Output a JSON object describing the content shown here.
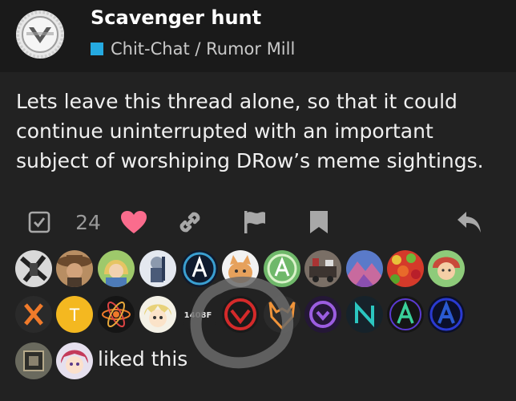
{
  "topic": {
    "title": "Scavenger hunt",
    "category": "Chit-Chat / Rumor Mill",
    "category_color": "#25aae1"
  },
  "post": {
    "body": "Lets leave this thread alone, so that it could continue uninterrupted with an important subject of worshiping DRow’s meme sightings."
  },
  "actions": {
    "like_count": "24",
    "like_color": "#fa6c8d",
    "icons": [
      "checkbox-icon",
      "heart-icon",
      "link-icon",
      "flag-icon",
      "bookmark-icon",
      "reply-icon"
    ]
  },
  "likers": {
    "text": "liked this",
    "avatar_badge": "1408F",
    "avatar_letter_t": "T"
  },
  "colors": {
    "background": "#222222",
    "header": "#1a1a1a",
    "accent_teal": "#3a9fd1"
  }
}
